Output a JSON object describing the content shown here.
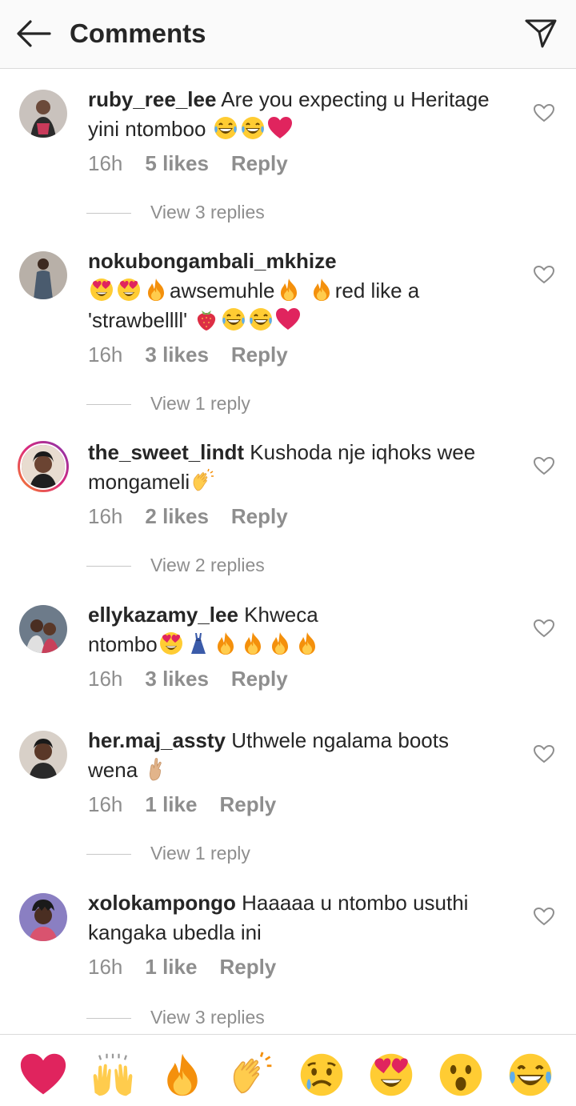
{
  "header": {
    "title": "Comments"
  },
  "comments": [
    {
      "username": "ruby_ree_lee",
      "text": "Are you expecting u Heritage yini ntomboo",
      "emojis_after": [
        "laugh-cry",
        "laugh-cry",
        "heart"
      ],
      "time": "16h",
      "likes": "5 likes",
      "reply": "Reply",
      "view_replies": "View 3 replies"
    },
    {
      "username": "nokubongambali_mkhize",
      "text_parts": [
        "awsemuhle",
        "red like a 'strawbellll'"
      ],
      "time": "16h",
      "likes": "3 likes",
      "reply": "Reply",
      "view_replies": "View 1 reply"
    },
    {
      "username": "the_sweet_lindt",
      "text": "Kushoda nje iqhoks wee mongameli",
      "time": "16h",
      "likes": "2 likes",
      "reply": "Reply",
      "view_replies": "View 2 replies"
    },
    {
      "username": "ellykazamy_lee",
      "text_parts": [
        "Khweca",
        "ntombo"
      ],
      "time": "16h",
      "likes": "3 likes",
      "reply": "Reply"
    },
    {
      "username": "her.maj_assty",
      "text_parts": [
        "Uthwele ngalama boots",
        "wena"
      ],
      "time": "16h",
      "likes": "1 like",
      "reply": "Reply",
      "view_replies": "View 1 reply"
    },
    {
      "username": "xolokampongo",
      "text": "Haaaaa u ntombo usuthi kangaka ubedla ini",
      "time": "16h",
      "likes": "1 like",
      "reply": "Reply",
      "view_replies": "View 3 replies"
    }
  ],
  "reactions": [
    "heart",
    "raised-hands",
    "fire",
    "clapping-hands",
    "sad-face",
    "heart-eyes",
    "surprised-face",
    "laugh-cry"
  ],
  "colors": {
    "text": "#262626",
    "meta": "#8e8e8e",
    "heart": "#e0245e",
    "header_bg": "#fafafa",
    "divider": "#dbdbdb"
  }
}
